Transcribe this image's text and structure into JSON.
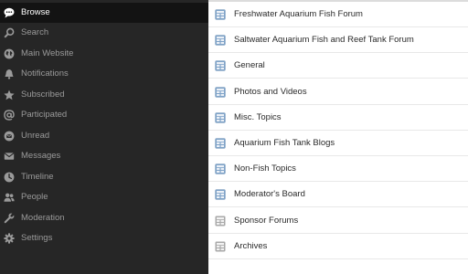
{
  "sidebar": {
    "items": [
      {
        "label": "Browse",
        "icon": "chat-bubble-icon",
        "active": true
      },
      {
        "label": "Search",
        "icon": "search-icon",
        "active": false
      },
      {
        "label": "Main Website",
        "icon": "globe-icon",
        "active": false
      },
      {
        "label": "Notifications",
        "icon": "bell-icon",
        "active": false
      },
      {
        "label": "Subscribed",
        "icon": "star-icon",
        "active": false
      },
      {
        "label": "Participated",
        "icon": "at-sign-icon",
        "active": false
      },
      {
        "label": "Unread",
        "icon": "unread-icon",
        "active": false
      },
      {
        "label": "Messages",
        "icon": "envelope-icon",
        "active": false
      },
      {
        "label": "Timeline",
        "icon": "clock-icon",
        "active": false
      },
      {
        "label": "People",
        "icon": "people-icon",
        "active": false
      },
      {
        "label": "Moderation",
        "icon": "wrench-icon",
        "active": false
      },
      {
        "label": "Settings",
        "icon": "gear-icon",
        "active": false
      }
    ]
  },
  "forums": {
    "items": [
      {
        "label": "Freshwater Aquarium Fish Forum",
        "icon": "forum-icon",
        "color": "blue"
      },
      {
        "label": "Saltwater Aquarium Fish and Reef Tank Forum",
        "icon": "forum-icon",
        "color": "blue"
      },
      {
        "label": "General",
        "icon": "forum-icon",
        "color": "blue"
      },
      {
        "label": "Photos and Videos",
        "icon": "forum-icon",
        "color": "blue"
      },
      {
        "label": "Misc. Topics",
        "icon": "forum-icon",
        "color": "blue"
      },
      {
        "label": "Aquarium Fish Tank Blogs",
        "icon": "forum-icon",
        "color": "blue"
      },
      {
        "label": "Non-Fish Topics",
        "icon": "forum-icon",
        "color": "blue"
      },
      {
        "label": "Moderator's Board",
        "icon": "forum-icon",
        "color": "blue"
      },
      {
        "label": "Sponsor Forums",
        "icon": "forum-icon",
        "color": "gray"
      },
      {
        "label": "Archives",
        "icon": "forum-icon",
        "color": "gray"
      }
    ]
  },
  "colors": {
    "sidebar_bg": "#262626",
    "sidebar_active_bg": "#131313",
    "sidebar_text": "#9a9a9a",
    "sidebar_active_text": "#ffffff",
    "forum_icon_blue": "#7fa3c8",
    "forum_icon_gray": "#a9a9a9"
  }
}
